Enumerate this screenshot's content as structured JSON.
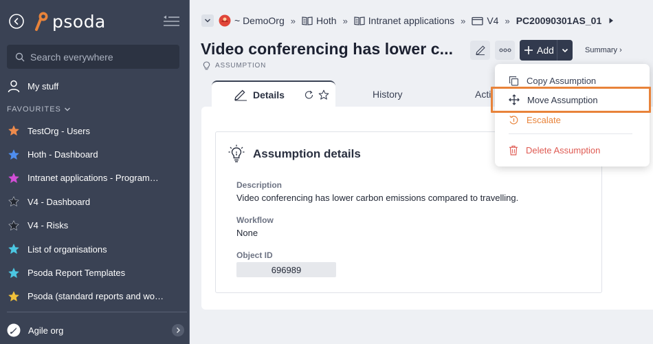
{
  "app": {
    "logo_text": "psoda"
  },
  "sidebar": {
    "search_placeholder": "Search everywhere",
    "my_stuff_label": "My stuff",
    "favourites_heading": "FAVOURITES",
    "favourites": [
      {
        "label": "TestOrg - Users",
        "color": "#ee8b4c"
      },
      {
        "label": "Hoth - Dashboard",
        "color": "#4f8ef0"
      },
      {
        "label": "Intranet applications - Programme...",
        "color": "#d24fd6"
      },
      {
        "label": "V4 - Dashboard",
        "color": "#22262f"
      },
      {
        "label": "V4 - Risks",
        "color": "#22262f"
      },
      {
        "label": "List of organisations",
        "color": "#4cc7e2"
      },
      {
        "label": "Psoda Report Templates",
        "color": "#4cc7e2"
      },
      {
        "label": "Psoda (standard reports and work...",
        "color": "#f0c03a"
      }
    ],
    "org_label": "Agile org"
  },
  "breadcrumbs": {
    "items": [
      "~ DemoOrg",
      "Hoth",
      "Intranet applications",
      "V4"
    ],
    "separator": "»",
    "current": "PC20090301AS_01"
  },
  "header": {
    "title": "Video conferencing has lower c...",
    "object_type": "ASSUMPTION",
    "add_label": "Add",
    "summary_label": "Summary ›"
  },
  "tabs": {
    "details": "Details",
    "history": "History",
    "actions": "Acti"
  },
  "card": {
    "title": "Assumption details",
    "fields": {
      "description_label": "Description",
      "description_value": "Video conferencing has lower carbon emissions compared to travelling.",
      "workflow_label": "Workflow",
      "workflow_value": "None",
      "object_id_label": "Object ID",
      "object_id_value": "696989"
    }
  },
  "menu": {
    "copy": "Copy Assumption",
    "move": "Move Assumption",
    "escalate": "Escalate",
    "delete": "Delete Assumption"
  },
  "colors": {
    "sidebar_bg": "#3a4254",
    "accent_orange": "#e8833a",
    "delete_red": "#df5a52",
    "add_button": "#323a4e"
  }
}
